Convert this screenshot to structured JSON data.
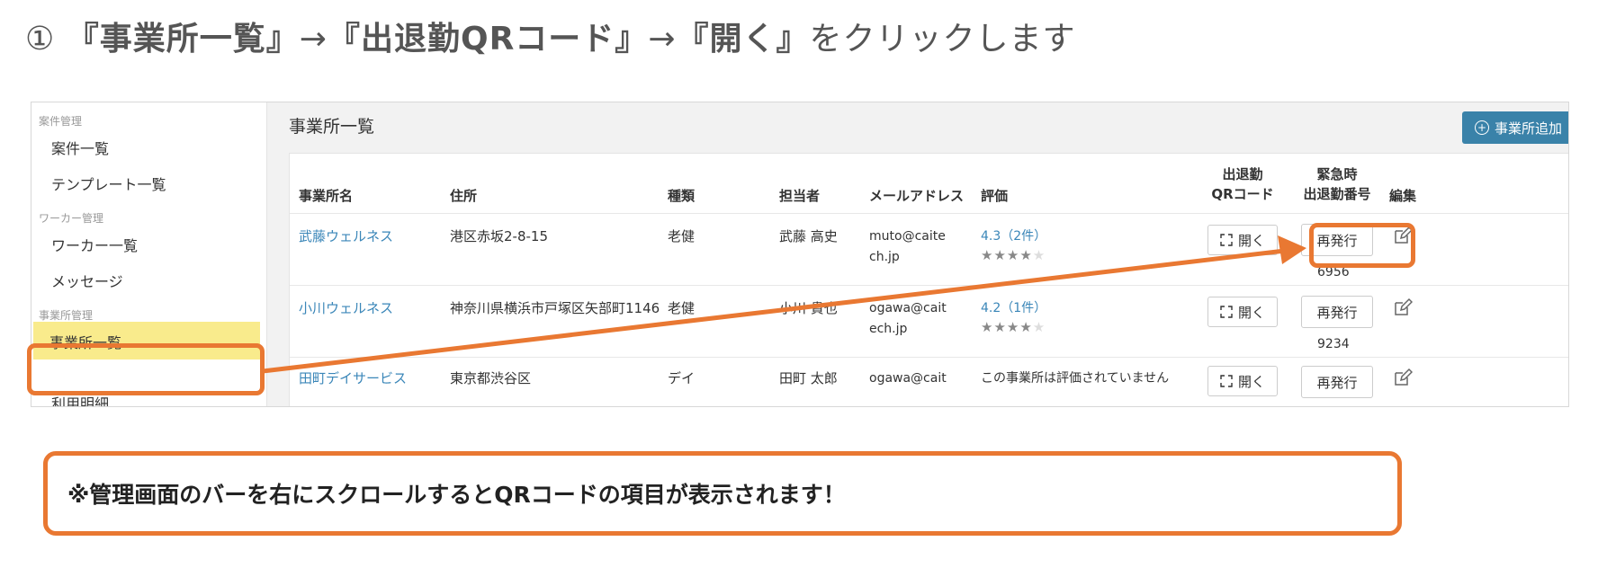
{
  "instruction": {
    "num": "①",
    "q1_open": "『",
    "q1_text": "事業所一覧",
    "q1_close": "』",
    "arrow1": "→",
    "q2_open": "『",
    "q2_text": "出退勤QRコード",
    "q2_close": "』",
    "arrow2": "→",
    "q3_open": "『",
    "q3_text": "開く",
    "q3_close": "』",
    "suffix": "をクリックします"
  },
  "sidebar": {
    "sections": [
      {
        "label": "案件管理",
        "items": [
          "案件一覧",
          "テンプレート一覧"
        ]
      },
      {
        "label": "ワーカー管理",
        "items": [
          "ワーカー一覧",
          "メッセージ"
        ]
      },
      {
        "label": "事業所管理",
        "items": [
          "事業所一覧",
          "利用明細"
        ]
      }
    ],
    "active_item": "事業所一覧"
  },
  "main": {
    "title": "事業所一覧",
    "add_button": "事業所追加"
  },
  "table": {
    "headers": {
      "name": "事業所名",
      "address": "住所",
      "type": "種類",
      "person": "担当者",
      "email": "メールアドレス",
      "rating": "評価",
      "qr_line1": "出退勤",
      "qr_line2": "QRコード",
      "emergency_line1": "緊急時",
      "emergency_line2": "出退勤番号",
      "edit": "編集"
    },
    "rows": [
      {
        "name": "武藤ウェルネス",
        "address": "港区赤坂2-8-15",
        "type": "老健",
        "person": "武藤 高史",
        "email_l1": "muto@caite",
        "email_l2": "ch.jp",
        "rating": "4.3（2件）",
        "stars": 4,
        "open": "開く",
        "reissue": "再発行",
        "emergency_no": "6956"
      },
      {
        "name": "小川ウェルネス",
        "address": "神奈川県横浜市戸塚区矢部町1146",
        "type": "老健",
        "person": "小川 貴也",
        "email_l1": "ogawa@cait",
        "email_l2": "ech.jp",
        "rating": "4.2（1件）",
        "stars": 4,
        "open": "開く",
        "reissue": "再発行",
        "emergency_no": "9234"
      },
      {
        "name": "田町デイサービス",
        "address": "東京都渋谷区",
        "type": "デイ",
        "person": "田町 太郎",
        "email_l1": "ogawa@cait",
        "rating": "この事業所は評価されていません",
        "open": "開く",
        "reissue": "再発行"
      }
    ]
  },
  "note": "※管理画面のバーを右にスクロールするとQRコードの項目が表示されます！",
  "colors": {
    "accent_orange": "#e97832",
    "highlight_yellow": "#f9eb8c",
    "link_blue": "#3a86b8",
    "add_button_blue": "#3a82a9"
  }
}
